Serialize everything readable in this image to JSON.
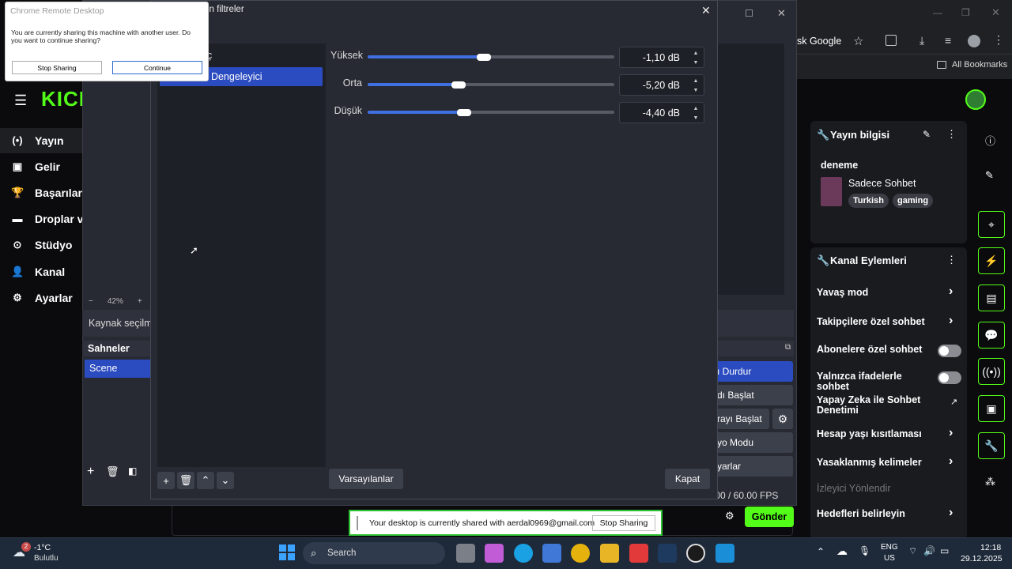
{
  "chrome": {
    "search_engine_fragment": "sk Google",
    "all_bookmarks": "All Bookmarks"
  },
  "kick": {
    "logo": "KICK",
    "nav": [
      {
        "label": "Yayın",
        "icon": "broadcast-icon"
      },
      {
        "label": "Gelir",
        "icon": "revenue-icon"
      },
      {
        "label": "Başarılar",
        "icon": "trophy-icon"
      },
      {
        "label": "Droplar ve",
        "icon": "drops-icon"
      },
      {
        "label": "Stüdyo",
        "icon": "studio-icon"
      },
      {
        "label": "Kanal",
        "icon": "channel-icon"
      },
      {
        "label": "Ayarlar",
        "icon": "gear-icon"
      }
    ],
    "stream_info": {
      "title": "Yayın bilgisi",
      "stream_title": "deneme",
      "category": "Sadece Sohbet",
      "tags": [
        "Turkish",
        "gaming"
      ]
    },
    "channel_actions": {
      "title": "Kanal Eylemleri",
      "items": [
        {
          "label": "Yavaş mod",
          "control": "chevron"
        },
        {
          "label": "Takipçilere özel sohbet",
          "control": "chevron"
        },
        {
          "label": "Abonelere özel sohbet",
          "control": "toggle"
        },
        {
          "label": "Yalnızca ifadelerle sohbet",
          "control": "toggle"
        },
        {
          "label": "Yapay Zeka ile Sohbet Denetimi",
          "control": "external"
        },
        {
          "label": "Hesap yaşı kısıtlaması",
          "control": "chevron"
        },
        {
          "label": "Yasaklanmış kelimeler",
          "control": "chevron"
        }
      ],
      "section_viewer": "İzleyici Yönlendir",
      "goals": "Hedefleri belirleyin"
    },
    "send_button": "Gönder"
  },
  "obs": {
    "zoom": "42%",
    "source_none": "Kaynak seçilme",
    "scenes_title": "Sahneler",
    "scene_item": "Scene",
    "controls": [
      "ı Durdur",
      "dı Başlat",
      "rayı Başlat",
      "yo Modu",
      "yarlar"
    ],
    "fps": ".00 / 60.00 FPS"
  },
  "filters": {
    "title_fragment": "in filtreler",
    "list": [
      "ç",
      "t Dengeleyici"
    ],
    "sliders": [
      {
        "label": "Yüksek",
        "value": "-1,10 dB",
        "level": 0.47
      },
      {
        "label": "Orta",
        "value": "-5,20 dB",
        "level": 0.37
      },
      {
        "label": "Düşük",
        "value": "-4,40 dB",
        "level": 0.39
      }
    ],
    "defaults_button": "Varsayılanlar",
    "close_button": "Kapat"
  },
  "remote_popup": {
    "title": "Chrome Remote Desktop",
    "message": "You are currently sharing this machine with another user. Do you want to continue sharing?",
    "stop_button": "Stop Sharing",
    "continue_button": "Continue"
  },
  "share_bar": {
    "message": "Your desktop is currently shared with aerdal0969@gmail.com",
    "stop_button": "Stop Sharing"
  },
  "taskbar": {
    "weather_temp": "-1°C",
    "weather_desc": "Bulutlu",
    "weather_badge": "2",
    "search": "Search",
    "lang_top": "ENG",
    "lang_bottom": "US",
    "time": "12:18",
    "date": "29.12.2025"
  },
  "colors": {
    "kick_green": "#53fc18",
    "obs_blue": "#2b4bc0",
    "slider_blue": "#3f6fe0"
  }
}
